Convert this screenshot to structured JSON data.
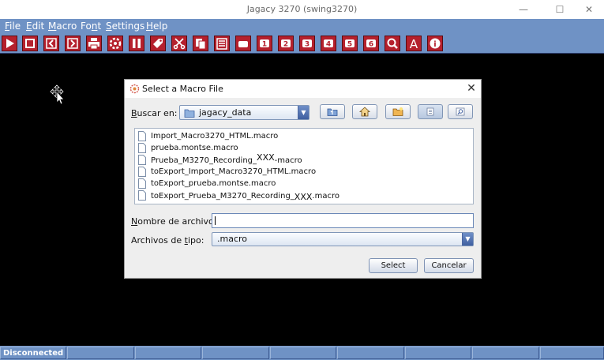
{
  "window": {
    "title": "Jagacy 3270 (swing3270)",
    "minimize_glyph": "—",
    "maximize_glyph": "☐",
    "close_glyph": "✕"
  },
  "menu": [
    {
      "label": "File",
      "mnemonic": "F",
      "rest": "ile"
    },
    {
      "label": "Edit",
      "mnemonic": "E",
      "rest": "dit"
    },
    {
      "label": "Macro",
      "mnemonic": "M",
      "rest": "acro"
    },
    {
      "label": "Font",
      "pre": "Fo",
      "mnemonic": "n",
      "rest": "t"
    },
    {
      "label": "Settings",
      "mnemonic": "S",
      "rest": "ettings"
    },
    {
      "label": "Help",
      "mnemonic": "H",
      "rest": "elp"
    }
  ],
  "toolbar": {
    "icons": [
      "play-icon",
      "stop-icon",
      "back-icon",
      "forward-icon",
      "print-icon",
      "settings-icon",
      "pause-icon",
      "tag-icon",
      "cut-icon",
      "copy-icon",
      "paste-icon",
      "clear-icon",
      "pf1-icon",
      "pf2-icon",
      "pf3-icon",
      "pf4-icon",
      "pf5-icon",
      "pf6-icon",
      "search-icon",
      "font-icon",
      "info-icon"
    ],
    "pf_labels": [
      "1",
      "2",
      "3",
      "4",
      "5",
      "6"
    ],
    "font_glyph": "A",
    "info_glyph": "i"
  },
  "status": {
    "text": "Disconnected"
  },
  "dialog": {
    "title": "Select a Macro File",
    "close_glyph": "✕",
    "look_in": {
      "label_mnemonic": "B",
      "label_rest": "uscar en:",
      "value": "jagacy_data"
    },
    "files": [
      {
        "pre": "Import_Macro3270_HTML.macro"
      },
      {
        "pre": "prueba.montse.macro"
      },
      {
        "pre": "Prueba_M3270_Recording_",
        "sup": "XXX",
        "post": "-macro"
      },
      {
        "pre": "toExport_Import_Macro3270_HTML.macro"
      },
      {
        "pre": "toExport_prueba.montse.macro"
      },
      {
        "pre": "toExport_Prueba_M3270_Recording_",
        "sub": "XXX",
        "post": ".macro"
      }
    ],
    "filename": {
      "label_mnemonic": "N",
      "label_rest": "ombre de archivo:",
      "value": ""
    },
    "filetype": {
      "label_pre": "Archivos de ",
      "label_mnemonic": "t",
      "label_rest": "ipo:",
      "value": ".macro"
    },
    "select_label": "Select",
    "cancel_label": "Cancelar"
  }
}
